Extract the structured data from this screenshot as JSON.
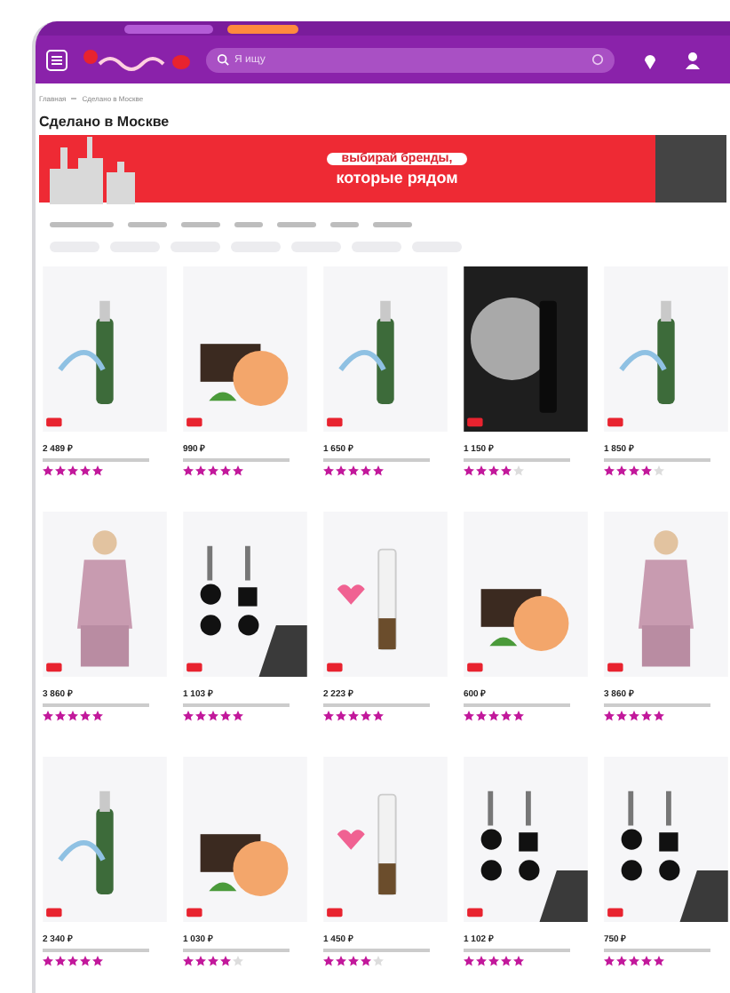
{
  "header": {
    "search": {
      "placeholder": "Я ищу"
    }
  },
  "breadcrumbs": [
    "Главная",
    "Сделано в Москве"
  ],
  "page_title": "Сделано в Москве",
  "banner": {
    "headline_1": "выбирай бренды,",
    "headline_2": "которые рядом"
  },
  "products": [
    {
      "kind": "bottle",
      "price": "2 489 ₽",
      "stars": 5
    },
    {
      "kind": "jar",
      "price": "990 ₽",
      "stars": 5
    },
    {
      "kind": "bottle",
      "price": "1 650 ₽",
      "stars": 5
    },
    {
      "kind": "dark",
      "price": "1 150 ₽",
      "stars": 4
    },
    {
      "kind": "bottle",
      "price": "1 850 ₽",
      "stars": 4
    },
    {
      "kind": "pajamas",
      "price": "3 860 ₽",
      "stars": 5
    },
    {
      "kind": "earrings",
      "price": "1 103 ₽",
      "stars": 5
    },
    {
      "kind": "tube",
      "price": "2 223 ₽",
      "stars": 5
    },
    {
      "kind": "jar",
      "price": "600 ₽",
      "stars": 5
    },
    {
      "kind": "pajamas",
      "price": "3 860 ₽",
      "stars": 5
    },
    {
      "kind": "bottle",
      "price": "2 340 ₽",
      "stars": 5
    },
    {
      "kind": "jar",
      "price": "1 030 ₽",
      "stars": 4
    },
    {
      "kind": "tube",
      "price": "1 450 ₽",
      "stars": 4
    },
    {
      "kind": "earrings",
      "price": "1 102 ₽",
      "stars": 5
    },
    {
      "kind": "earrings",
      "price": "750 ₽",
      "stars": 5
    }
  ]
}
